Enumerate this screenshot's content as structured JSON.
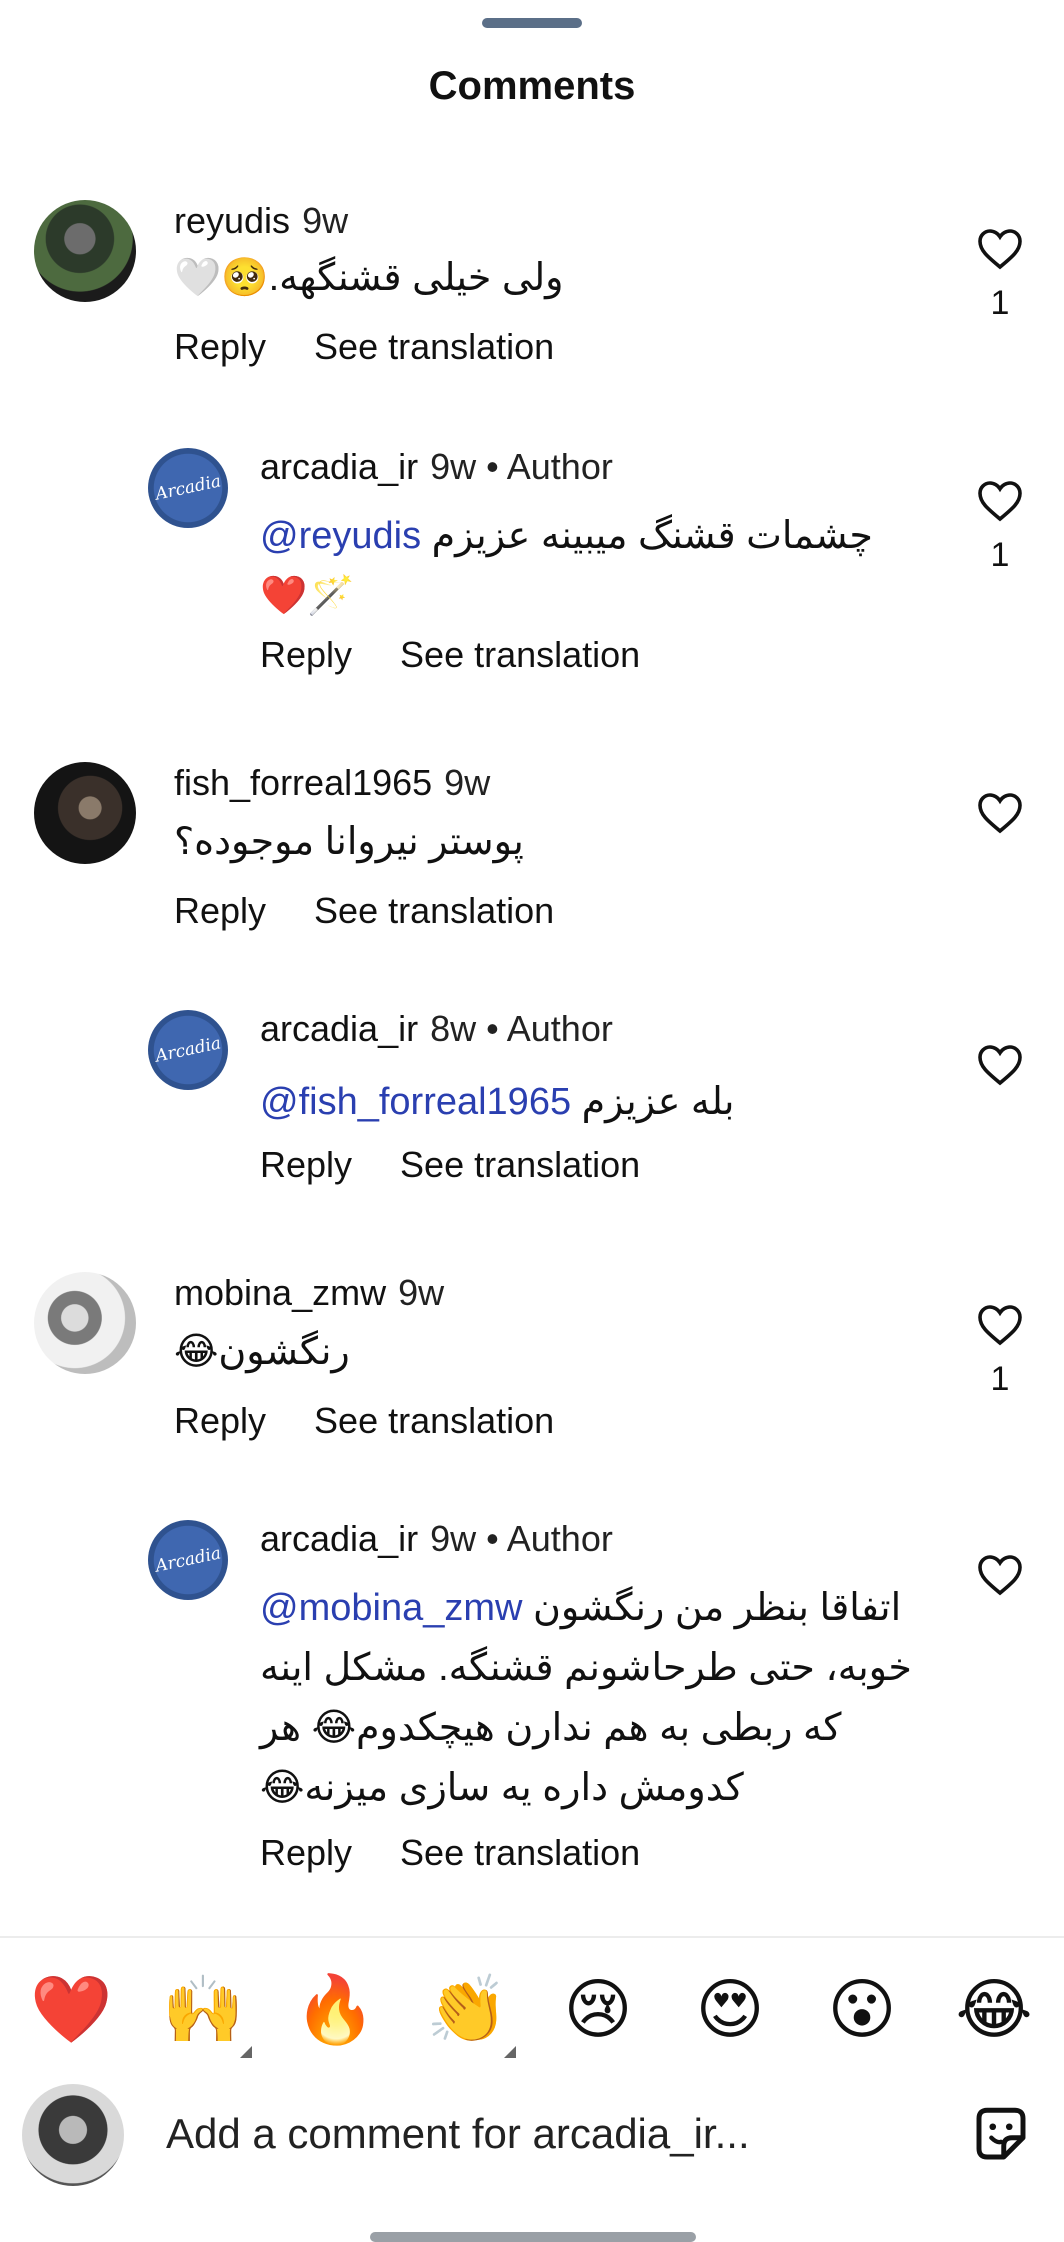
{
  "sheet": {
    "title": "Comments"
  },
  "comments": [
    {
      "username": "reyudis",
      "time": "9w",
      "author_badge": "",
      "text": "ولی خیلی قشنگهه.🥺🤍",
      "mention": "",
      "reply_label": "Reply",
      "translate_label": "See translation",
      "like_count": "1",
      "avatar": "reyudis-avatar"
    },
    {
      "username": "arcadia_ir",
      "time": "9w",
      "author_badge": "• Author",
      "text": "چشمات قشنگ میبینه عزیزم\n🪄❤️",
      "mention": "@reyudis",
      "reply_label": "Reply",
      "translate_label": "See translation",
      "like_count": "1",
      "avatar": "arcadia-avatar",
      "avatar_text": "Arcadia"
    },
    {
      "username": "fish_forreal1965",
      "time": "9w",
      "author_badge": "",
      "text": "پوستر نیروانا موجوده؟",
      "mention": "",
      "reply_label": "Reply",
      "translate_label": "See translation",
      "like_count": "",
      "avatar": "fish-avatar"
    },
    {
      "username": "arcadia_ir",
      "time": "8w",
      "author_badge": "• Author",
      "text": "بله عزیزم",
      "mention": "@fish_forreal1965",
      "reply_label": "Reply",
      "translate_label": "See translation",
      "like_count": "",
      "avatar": "arcadia-avatar",
      "avatar_text": "Arcadia"
    },
    {
      "username": "mobina_zmw",
      "time": "9w",
      "author_badge": "",
      "text": "رنگشون😂",
      "mention": "",
      "reply_label": "Reply",
      "translate_label": "See translation",
      "like_count": "1",
      "avatar": "mobina-avatar"
    },
    {
      "username": "arcadia_ir",
      "time": "9w",
      "author_badge": "• Author",
      "text": "اتفاقا بنظر من رنگشون\nخوبه، حتی طرحاشونم قشنگه. مشکل اینه\nکه ربطی به هم ندارن هیچکدوم😂 هر\nکدومش داره یه سازی میزنه😂",
      "mention": "@mobina_zmw",
      "reply_label": "Reply",
      "translate_label": "See translation",
      "like_count": "",
      "avatar": "arcadia-avatar",
      "avatar_text": "Arcadia"
    }
  ],
  "quick_reactions": [
    {
      "emoji": "❤️",
      "name": "red-heart-emoji"
    },
    {
      "emoji": "🙌",
      "name": "raising-hands-emoji"
    },
    {
      "emoji": "🔥",
      "name": "fire-emoji"
    },
    {
      "emoji": "👏",
      "name": "clapping-hands-emoji"
    },
    {
      "emoji": "😢",
      "name": "crying-face-emoji"
    },
    {
      "emoji": "😍",
      "name": "heart-eyes-emoji"
    },
    {
      "emoji": "😮",
      "name": "surprised-face-emoji"
    },
    {
      "emoji": "😂",
      "name": "tears-of-joy-emoji"
    }
  ],
  "composer": {
    "placeholder": "Add a comment for arcadia_ir...",
    "sticker_icon": "sticker-icon"
  }
}
